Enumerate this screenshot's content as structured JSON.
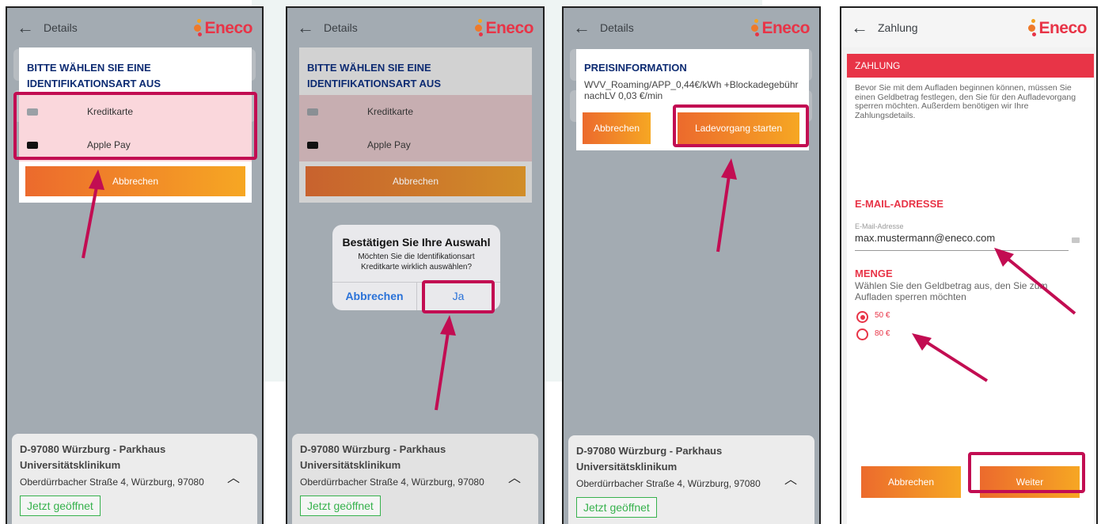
{
  "colors": {
    "brand": "#e83447",
    "highlight": "#c20d52",
    "modal_title": "#0d2b72",
    "open_green": "#37b24d"
  },
  "screen1": {
    "title": "Details",
    "logo": "Eneco",
    "modal_title": "BITTE WÄHLEN SIE EINE IDENTIFIKATIONSART AUS",
    "options": [
      {
        "label": "Kreditkarte",
        "icon": "credit-card-icon"
      },
      {
        "label": "Apple Pay",
        "icon": "apple-pay-icon"
      }
    ],
    "cancel": "Abbrechen",
    "location": {
      "name_line1": "D-97080 Würzburg - Parkhaus",
      "name_line2": "Universitätsklinikum",
      "address": "Oberdürrbacher Straße 4, Würzburg, 97080",
      "status": "Jetzt geöffnet"
    }
  },
  "screen2": {
    "title": "Details",
    "logo": "Eneco",
    "modal_title": "BITTE WÄHLEN SIE EINE IDENTIFIKATIONSART AUS",
    "options": [
      {
        "label": "Kreditkarte",
        "icon": "credit-card-icon"
      },
      {
        "label": "Apple Pay",
        "icon": "apple-pay-icon"
      }
    ],
    "cancel": "Abbrechen",
    "dialog": {
      "title": "Bestätigen Sie Ihre Auswahl",
      "message": "Möchten Sie die Identifikationsart Kreditkarte wirklich auswählen?",
      "cancel": "Abbrechen",
      "confirm": "Ja"
    },
    "location": {
      "name_line1": "D-97080 Würzburg - Parkhaus",
      "name_line2": "Universitätsklinikum",
      "address": "Oberdürrbacher Straße 4, Würzburg, 97080",
      "status": "Jetzt geöffnet"
    }
  },
  "screen3": {
    "title": "Details",
    "logo": "Eneco",
    "modal_title": "PREISINFORMATION",
    "price_text": "WVV_Roaming/APP_0,44€/kWh +Blockadegebühr nachLV 0,03 €/min",
    "cancel": "Abbrechen",
    "start": "Ladevorgang starten",
    "location": {
      "name_line1": "D-97080 Würzburg - Parkhaus",
      "name_line2": "Universitätsklinikum",
      "address": "Oberdürrbacher Straße 4, Würzburg, 97080",
      "status": "Jetzt geöffnet"
    }
  },
  "screen4": {
    "title": "Zahlung",
    "logo": "Eneco",
    "header": "ZAHLUNG",
    "intro": "Bevor Sie mit dem Aufladen beginnen können, müssen Sie einen Geldbetrag festlegen, den Sie für den Aufladevorgang sperren möchten. Außerdem benötigen wir Ihre Zahlungsdetails.",
    "email_heading": "E-MAIL-ADRESSE",
    "email_label": "E-Mail-Adresse",
    "email_value": "max.mustermann@eneco.com",
    "amount_heading": "MENGE",
    "amount_text": "Wählen Sie den Geldbetrag aus, den Sie zum Aufladen sperren möchten",
    "amounts": [
      {
        "label": "50 €",
        "selected": true
      },
      {
        "label": "80 €",
        "selected": false
      }
    ],
    "cancel": "Abbrechen",
    "next": "Weiter"
  }
}
